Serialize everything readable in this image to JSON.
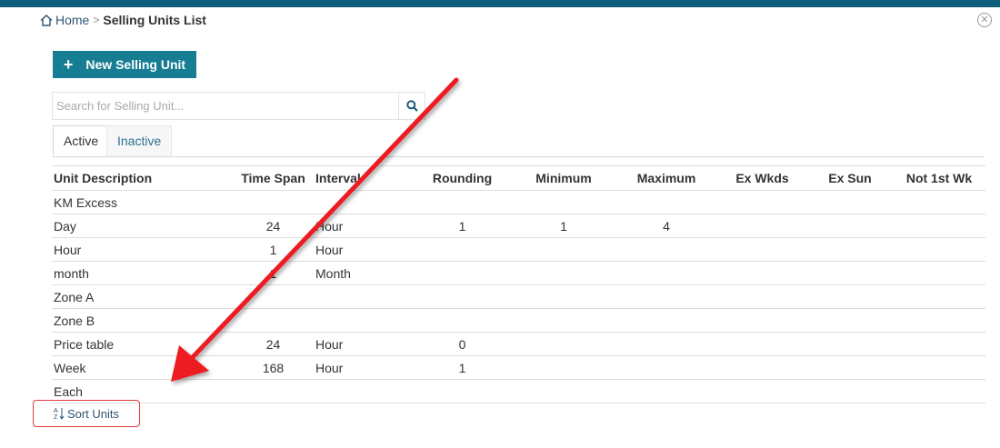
{
  "breadcrumb": {
    "home": "Home",
    "separator": ">",
    "current": "Selling Units List"
  },
  "toolbar": {
    "new_button": "New Selling Unit",
    "plus_icon": "+"
  },
  "search": {
    "placeholder": "Search for Selling Unit...",
    "value": ""
  },
  "tabs": [
    {
      "label": "Active",
      "selected": true
    },
    {
      "label": "Inactive",
      "selected": false
    }
  ],
  "table": {
    "columns": [
      "Unit Description",
      "Time Span",
      "Interval",
      "Rounding",
      "Minimum",
      "Maximum",
      "Ex Wkds",
      "Ex Sun",
      "Not 1st Wk"
    ],
    "rows": [
      {
        "desc": "KM Excess",
        "span": "",
        "interval": "",
        "rounding": "",
        "minimum": "",
        "maximum": ""
      },
      {
        "desc": "Day",
        "span": "24",
        "interval": "Hour",
        "rounding": "1",
        "minimum": "1",
        "maximum": "4"
      },
      {
        "desc": "Hour",
        "span": "1",
        "interval": "Hour",
        "rounding": "",
        "minimum": "",
        "maximum": ""
      },
      {
        "desc": "month",
        "span": "1",
        "interval": "Month",
        "rounding": "",
        "minimum": "",
        "maximum": ""
      },
      {
        "desc": "Zone A",
        "span": "",
        "interval": "",
        "rounding": "",
        "minimum": "",
        "maximum": ""
      },
      {
        "desc": "Zone B",
        "span": "",
        "interval": "",
        "rounding": "",
        "minimum": "",
        "maximum": ""
      },
      {
        "desc": "Price table",
        "span": "24",
        "interval": "Hour",
        "rounding": "0",
        "minimum": "",
        "maximum": ""
      },
      {
        "desc": "Week",
        "span": "168",
        "interval": "Hour",
        "rounding": "1",
        "minimum": "",
        "maximum": ""
      },
      {
        "desc": "Each",
        "span": "",
        "interval": "",
        "rounding": "",
        "minimum": "",
        "maximum": ""
      }
    ]
  },
  "footer": {
    "sort_button": "Sort Units"
  },
  "colors": {
    "header_bar": "#0f5d7a",
    "primary_button": "#167d93",
    "annotation": "#e53a3a",
    "link": "#2f5573"
  },
  "icons": {
    "home": "home-icon",
    "search": "search-icon",
    "close": "close-icon",
    "sort": "sort-az-icon",
    "annotation": "red-arrow"
  }
}
